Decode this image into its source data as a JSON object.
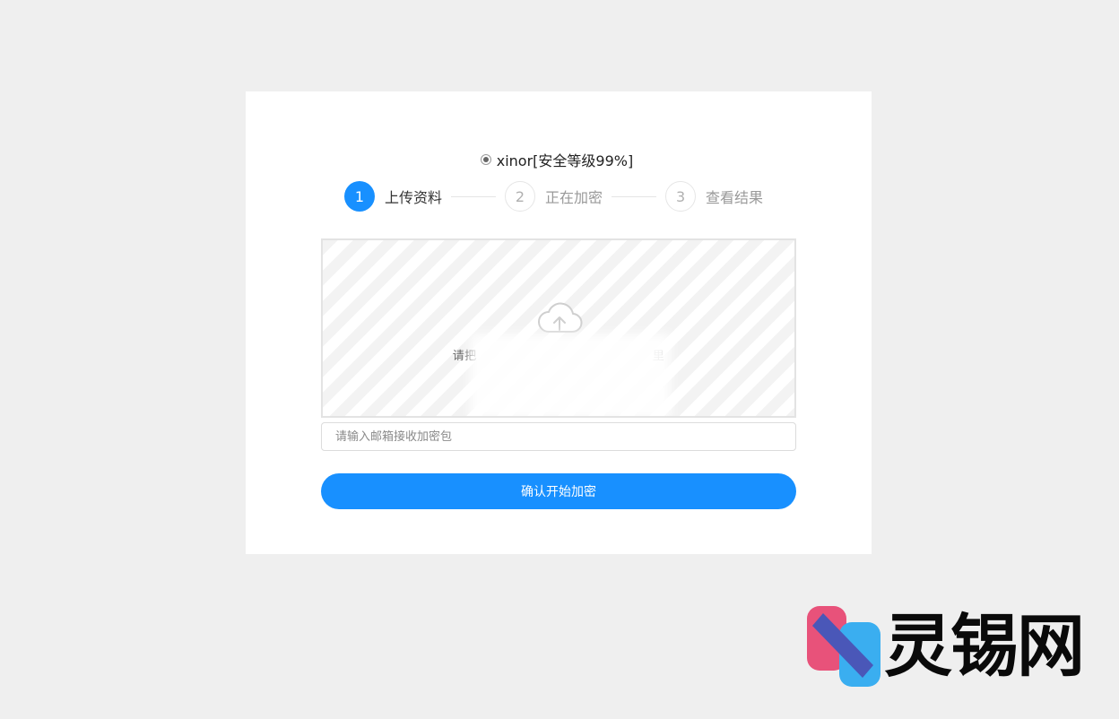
{
  "mode": {
    "label": "xinor[安全等级99%]",
    "selected": true
  },
  "steps": [
    {
      "number": "1",
      "label": "上传资料",
      "state": "active"
    },
    {
      "number": "2",
      "label": "正在加密",
      "state": "inactive"
    },
    {
      "number": "3",
      "label": "查看结果",
      "state": "inactive"
    }
  ],
  "dropzone": {
    "icon": "cloud-upload-icon",
    "text_start": "请把",
    "text_end": "里"
  },
  "email": {
    "placeholder": "请输入邮箱接收加密包",
    "value": ""
  },
  "submit": {
    "label": "确认开始加密"
  },
  "watermark": {
    "text": "灵锡网"
  },
  "colors": {
    "accent": "#1890ff",
    "background": "#efefef",
    "logo_pink": "#e8527a",
    "logo_blue": "#3aaef0"
  }
}
